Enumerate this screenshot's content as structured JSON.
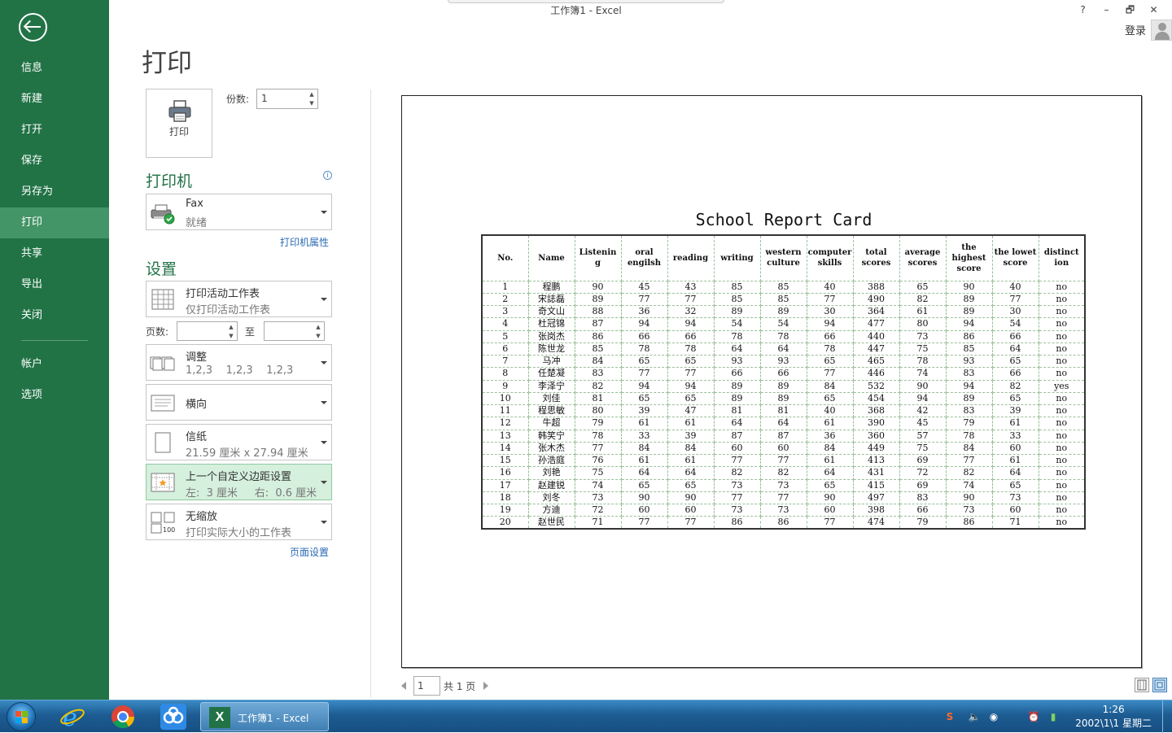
{
  "window": {
    "title": "工作簿1 - Excel",
    "help": "?",
    "minimize": "–",
    "restore": "🗗",
    "close": "✕",
    "login": "登录"
  },
  "sidebar": {
    "items": [
      {
        "label": "信息"
      },
      {
        "label": "新建"
      },
      {
        "label": "打开"
      },
      {
        "label": "保存"
      },
      {
        "label": "另存为"
      },
      {
        "label": "打印"
      },
      {
        "label": "共享"
      },
      {
        "label": "导出"
      },
      {
        "label": "关闭"
      },
      {
        "label": "帐户"
      },
      {
        "label": "选项"
      }
    ],
    "active": "打印"
  },
  "print": {
    "title": "打印",
    "button_label": "打印",
    "copies_label": "份数:",
    "copies_value": "1"
  },
  "printer": {
    "heading": "打印机",
    "name": "Fax",
    "status": "就绪",
    "properties_link": "打印机属性"
  },
  "settings": {
    "heading": "设置",
    "scope": {
      "title": "打印活动工作表",
      "sub": "仅打印活动工作表"
    },
    "pages_label": "页数:",
    "pages_to_label": "至",
    "collate": {
      "title": "调整",
      "sub": "1,2,3    1,2,3    1,2,3"
    },
    "orientation": {
      "title": "横向"
    },
    "paper": {
      "title": "信纸",
      "sub": "21.59 厘米 x 27.94 厘米"
    },
    "margins": {
      "title": "上一个自定义边距设置",
      "sub": "左:  3 厘米     右:  0.6 厘米"
    },
    "scaling": {
      "title": "无缩放",
      "sub": "打印实际大小的工作表"
    },
    "page_setup_link": "页面设置"
  },
  "pager": {
    "current": "1",
    "total": "共 1 页"
  },
  "report": {
    "title": "School Report Card",
    "headers": [
      "No.",
      "Name",
      "Listenin g",
      "oral engilsh",
      "reading",
      "writing",
      "western culture",
      "computer skills",
      "total scores",
      "average scores",
      "the highest score",
      "the lowet score",
      "distinct ion"
    ],
    "rows": [
      [
        "1",
        "程鹏",
        "90",
        "45",
        "43",
        "85",
        "85",
        "40",
        "388",
        "65",
        "90",
        "40",
        "no"
      ],
      [
        "2",
        "宋誌磊",
        "89",
        "77",
        "77",
        "85",
        "85",
        "77",
        "490",
        "82",
        "89",
        "77",
        "no"
      ],
      [
        "3",
        "奇文山",
        "88",
        "36",
        "32",
        "89",
        "89",
        "30",
        "364",
        "61",
        "89",
        "30",
        "no"
      ],
      [
        "4",
        "杜冠锦",
        "87",
        "94",
        "94",
        "54",
        "54",
        "94",
        "477",
        "80",
        "94",
        "54",
        "no"
      ],
      [
        "5",
        "张岗杰",
        "86",
        "66",
        "66",
        "78",
        "78",
        "66",
        "440",
        "73",
        "86",
        "66",
        "no"
      ],
      [
        "6",
        "陈世龙",
        "85",
        "78",
        "78",
        "64",
        "64",
        "78",
        "447",
        "75",
        "85",
        "64",
        "no"
      ],
      [
        "7",
        "马冲",
        "84",
        "65",
        "65",
        "93",
        "93",
        "65",
        "465",
        "78",
        "93",
        "65",
        "no"
      ],
      [
        "8",
        "任楚凝",
        "83",
        "77",
        "77",
        "66",
        "66",
        "77",
        "446",
        "74",
        "83",
        "66",
        "no"
      ],
      [
        "9",
        "李泽宁",
        "82",
        "94",
        "94",
        "89",
        "89",
        "84",
        "532",
        "90",
        "94",
        "82",
        "yes"
      ],
      [
        "10",
        "刘佳",
        "81",
        "65",
        "65",
        "89",
        "89",
        "65",
        "454",
        "94",
        "89",
        "65",
        "no"
      ],
      [
        "11",
        "程思敏",
        "80",
        "39",
        "47",
        "81",
        "81",
        "40",
        "368",
        "42",
        "83",
        "39",
        "no"
      ],
      [
        "12",
        "牛超",
        "79",
        "61",
        "61",
        "64",
        "64",
        "61",
        "390",
        "45",
        "79",
        "61",
        "no"
      ],
      [
        "13",
        "韩笑宁",
        "78",
        "33",
        "39",
        "87",
        "87",
        "36",
        "360",
        "57",
        "78",
        "33",
        "no"
      ],
      [
        "14",
        "张木杰",
        "77",
        "84",
        "84",
        "60",
        "60",
        "84",
        "449",
        "75",
        "84",
        "60",
        "no"
      ],
      [
        "15",
        "孙浩庭",
        "76",
        "61",
        "61",
        "77",
        "77",
        "61",
        "413",
        "69",
        "77",
        "61",
        "no"
      ],
      [
        "16",
        "刘艳",
        "75",
        "64",
        "64",
        "82",
        "82",
        "64",
        "431",
        "72",
        "82",
        "64",
        "no"
      ],
      [
        "17",
        "赵建锐",
        "74",
        "65",
        "65",
        "73",
        "73",
        "65",
        "415",
        "69",
        "74",
        "65",
        "no"
      ],
      [
        "18",
        "刘冬",
        "73",
        "90",
        "90",
        "77",
        "77",
        "90",
        "497",
        "83",
        "90",
        "73",
        "no"
      ],
      [
        "19",
        "方迪",
        "72",
        "60",
        "60",
        "73",
        "73",
        "60",
        "398",
        "66",
        "73",
        "60",
        "no"
      ],
      [
        "20",
        "赵世民",
        "71",
        "77",
        "77",
        "86",
        "86",
        "77",
        "474",
        "79",
        "86",
        "71",
        "no"
      ]
    ]
  },
  "taskbar": {
    "task_label": "工作簿1 - Excel",
    "time": "1:26",
    "date": "2002\\1\\1 星期二"
  },
  "colors": {
    "accent": "#217346",
    "sidebar_active": "#439467",
    "margins_highlight": "#d5f0dd"
  }
}
